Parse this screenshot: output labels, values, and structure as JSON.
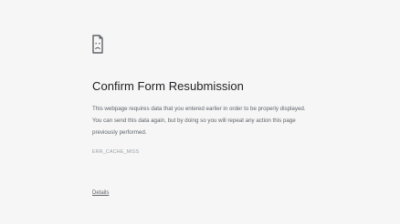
{
  "error_page": {
    "icon": "sad-document-icon",
    "title": "Confirm Form Resubmission",
    "message": "This webpage requires data that you entered earlier in order to be properly displayed. You can send this data again, but by doing so you will repeat any action this page previously performed.",
    "error_code": "ERR_CACHE_MISS",
    "details_label": "Details"
  },
  "colors": {
    "background": "#f6f6f6",
    "title": "#202124",
    "body_text": "#5f6368",
    "error_code": "#9aa0a6"
  }
}
